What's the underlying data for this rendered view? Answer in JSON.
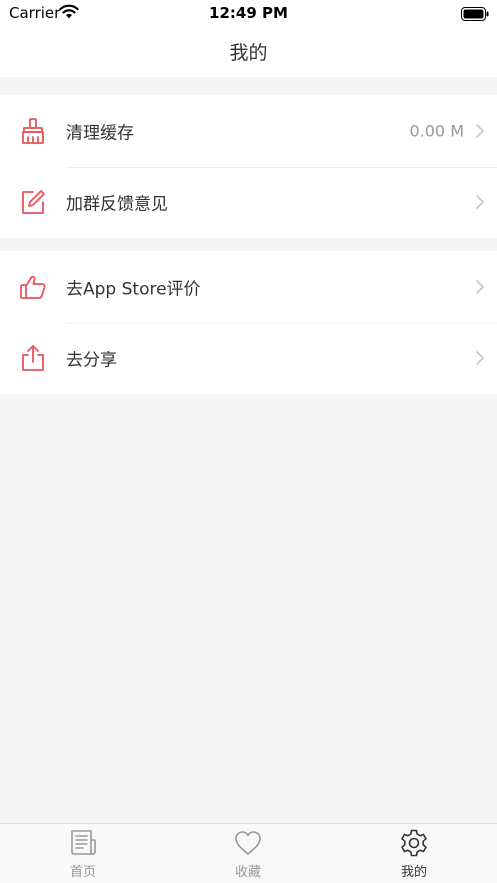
{
  "status_bar": {
    "carrier": "Carrier",
    "time": "12:49 PM"
  },
  "nav": {
    "title": "我的"
  },
  "sections": [
    {
      "rows": [
        {
          "label": "清理缓存",
          "value": "0.00 M",
          "icon": "broom-icon"
        },
        {
          "label": "加群反馈意见",
          "value": "",
          "icon": "edit-icon"
        }
      ]
    },
    {
      "rows": [
        {
          "label": "去App Store评价",
          "value": "",
          "icon": "thumbs-up-icon"
        },
        {
          "label": "去分享",
          "value": "",
          "icon": "share-icon"
        }
      ]
    }
  ],
  "tabs": [
    {
      "label": "首页",
      "icon": "newspaper-icon",
      "active": false
    },
    {
      "label": "收藏",
      "icon": "heart-icon",
      "active": false
    },
    {
      "label": "我的",
      "icon": "gear-icon",
      "active": true
    }
  ],
  "colors": {
    "accent": "#e8545a",
    "tab_inactive": "#999999",
    "tab_active": "#333333"
  }
}
